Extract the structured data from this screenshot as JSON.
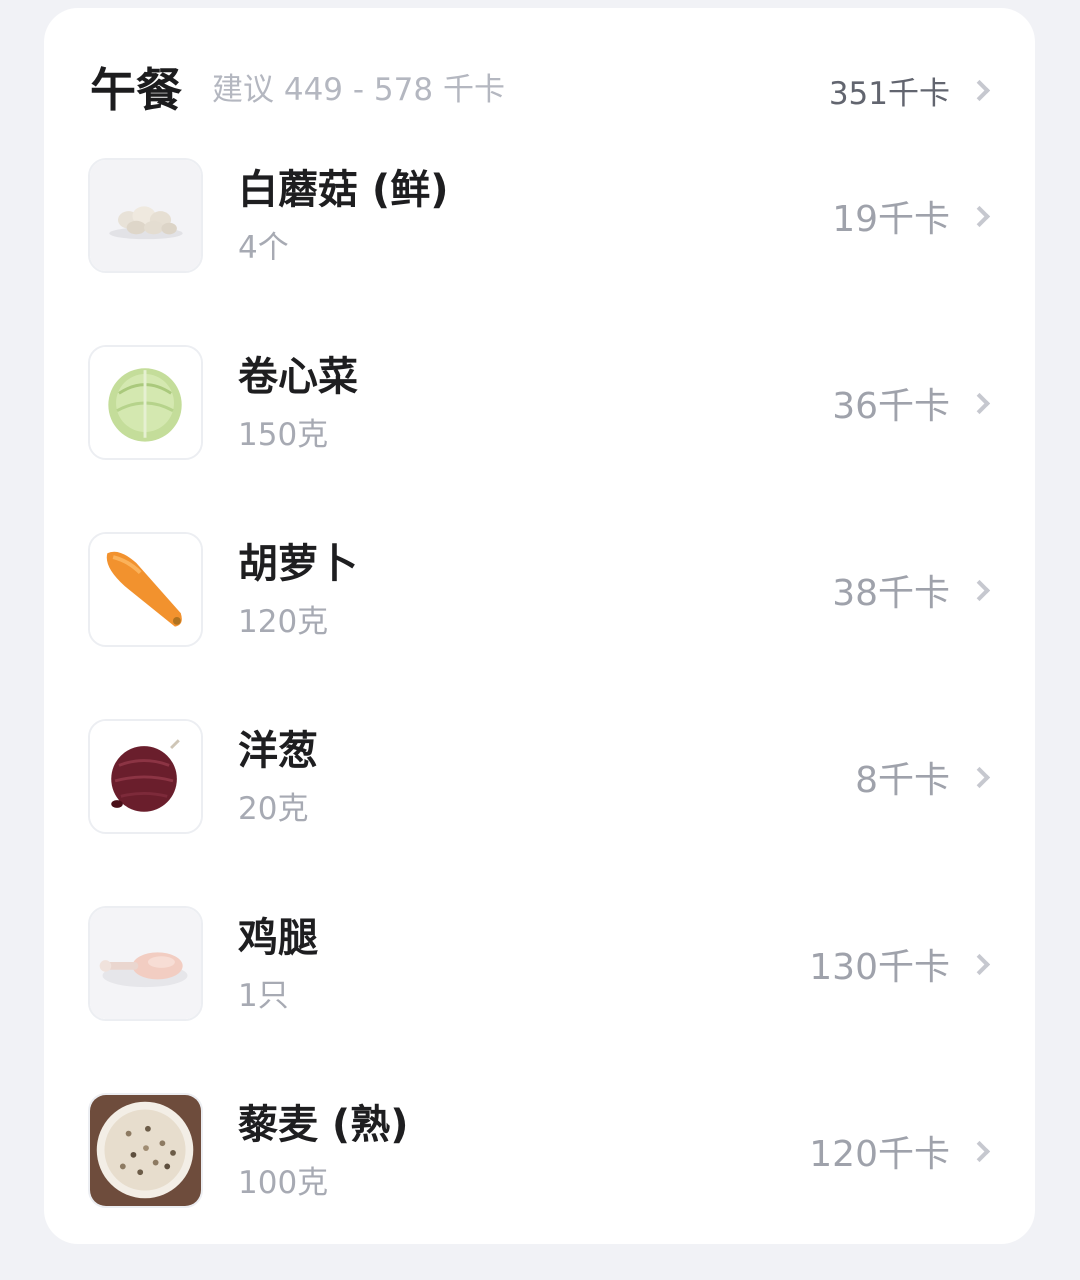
{
  "meal": {
    "title": "午餐",
    "suggestion": "建议 449 - 578 千卡",
    "total": "351千卡"
  },
  "colors": {
    "background": "#f1f2f6",
    "card": "#ffffff",
    "title_text": "#1c1c1e",
    "secondary_text": "#a7aab3",
    "chevron": "#c6c8cf"
  },
  "foods": [
    {
      "name": "白蘑菇 (鲜)",
      "amount": "4个",
      "kcal": "19千卡",
      "icon": "mushroom-photo"
    },
    {
      "name": "卷心菜",
      "amount": "150克",
      "kcal": "36千卡",
      "icon": "cabbage-photo"
    },
    {
      "name": "胡萝卜",
      "amount": "120克",
      "kcal": "38千卡",
      "icon": "carrot-photo"
    },
    {
      "name": "洋葱",
      "amount": "20克",
      "kcal": "8千卡",
      "icon": "onion-photo"
    },
    {
      "name": "鸡腿",
      "amount": "1只",
      "kcal": "130千卡",
      "icon": "chicken-leg-photo"
    },
    {
      "name": "藜麦 (熟)",
      "amount": "100克",
      "kcal": "120千卡",
      "icon": "quinoa-photo"
    }
  ]
}
